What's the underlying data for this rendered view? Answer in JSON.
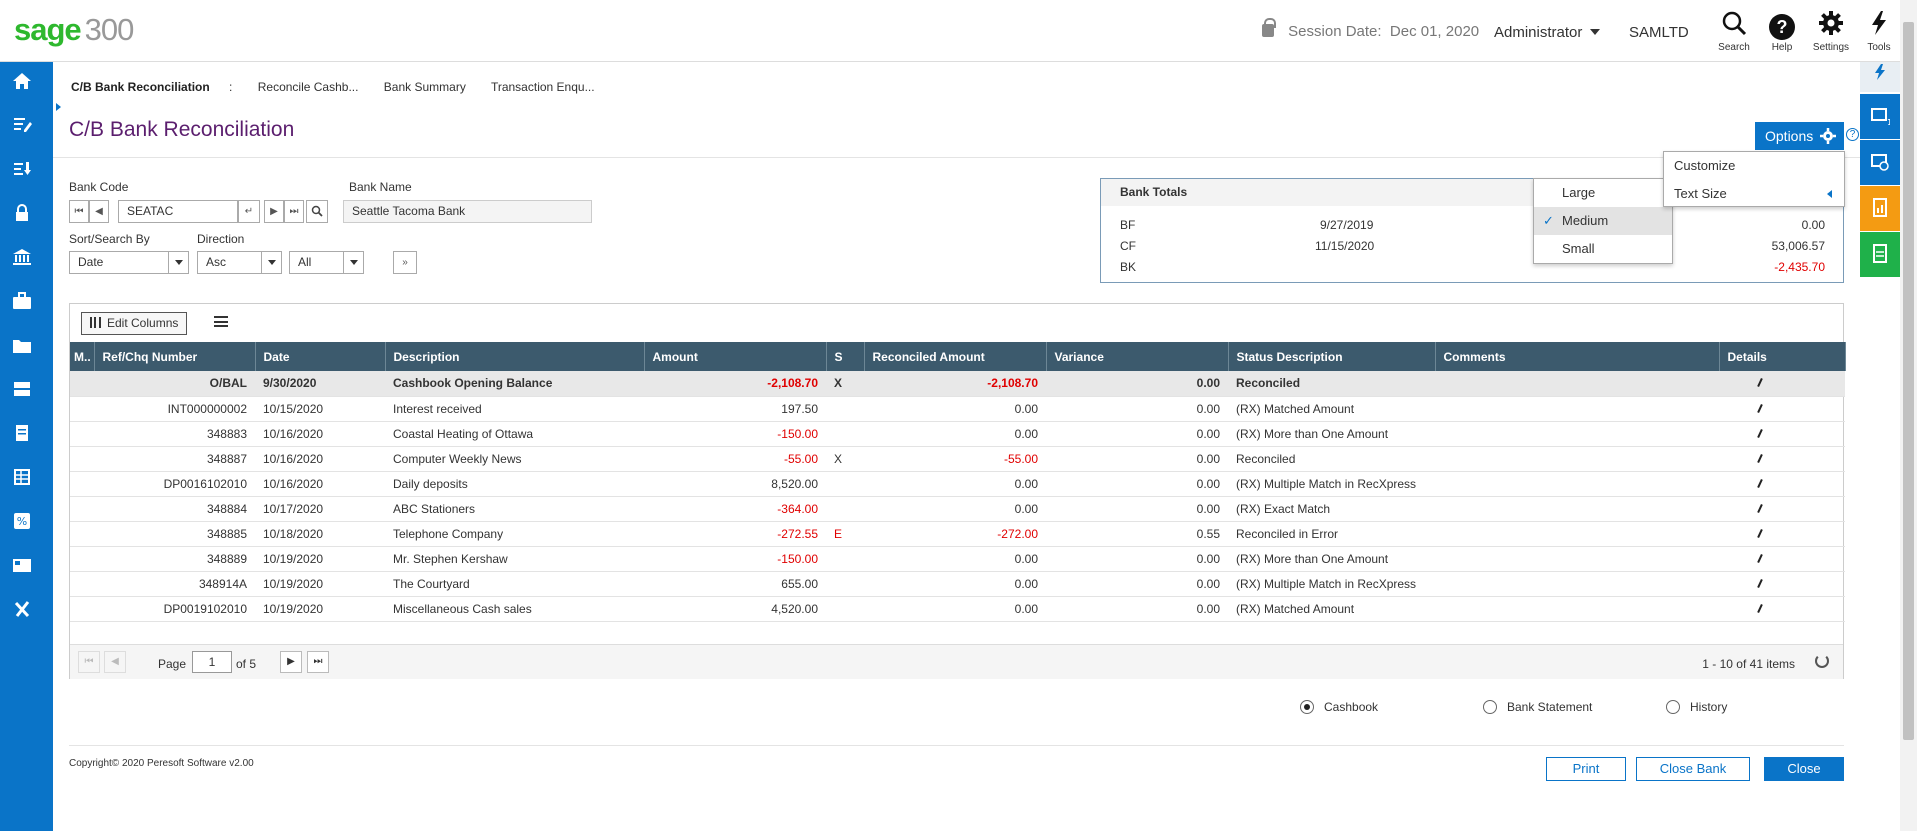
{
  "app": {
    "logo_brand": "sage",
    "logo_version": "300"
  },
  "header": {
    "session_label": "Session Date:",
    "session_date": "Dec 01, 2020",
    "user": "Administrator",
    "company": "SAMLTD",
    "icons": [
      {
        "name": "search-icon",
        "label": "Search"
      },
      {
        "name": "help-icon",
        "label": "Help"
      },
      {
        "name": "settings-icon",
        "label": "Settings"
      },
      {
        "name": "tools-icon",
        "label": "Tools"
      }
    ]
  },
  "breadcrumb": {
    "items": [
      "C/B Bank Reconciliation",
      ":",
      "Reconcile Cashb...",
      "Bank Summary",
      "Transaction Enqu..."
    ]
  },
  "page": {
    "title": "C/B Bank Reconciliation",
    "options_label": "Options"
  },
  "form": {
    "bank_code_label": "Bank Code",
    "bank_code_value": "SEATAC",
    "bank_name_label": "Bank Name",
    "bank_name_value": "Seattle Tacoma Bank",
    "sort_label": "Sort/Search By",
    "sort_value": "Date",
    "direction_label": "Direction",
    "direction_value": "Asc",
    "filter_value": "All"
  },
  "bank_totals": {
    "title": "Bank Totals",
    "rows": [
      {
        "code": "BF",
        "date": "9/27/2019",
        "amount": "0.00"
      },
      {
        "code": "CF",
        "date": "11/15/2020",
        "amount": "53,006.57"
      },
      {
        "code": "BK",
        "date": "",
        "amount": "-2,435.70"
      }
    ]
  },
  "options_menu": {
    "items": [
      "Customize",
      "Text Size"
    ]
  },
  "text_size_menu": {
    "items": [
      "Large",
      "Medium",
      "Small"
    ],
    "selected": "Medium"
  },
  "grid": {
    "edit_columns_label": "Edit Columns",
    "columns": [
      "M..",
      "Ref/Chq Number",
      "Date",
      "Description",
      "Amount",
      "S",
      "Reconciled Amount",
      "Variance",
      "Status Description",
      "Comments",
      "Details"
    ],
    "rows": [
      {
        "ref": "O/BAL",
        "date": "9/30/2020",
        "desc": "Cashbook Opening Balance",
        "amount": "-2,108.70",
        "s": "X",
        "rec": "-2,108.70",
        "var": "0.00",
        "status": "Reconciled",
        "comments": ""
      },
      {
        "ref": "INT000000002",
        "date": "10/15/2020",
        "desc": "Interest received",
        "amount": "197.50",
        "s": "",
        "rec": "0.00",
        "var": "0.00",
        "status": "(RX) Matched Amount",
        "comments": ""
      },
      {
        "ref": "348883",
        "date": "10/16/2020",
        "desc": "Coastal Heating of Ottawa",
        "amount": "-150.00",
        "s": "",
        "rec": "0.00",
        "var": "0.00",
        "status": "(RX) More than One Amount",
        "comments": ""
      },
      {
        "ref": "348887",
        "date": "10/16/2020",
        "desc": "Computer Weekly News",
        "amount": "-55.00",
        "s": "X",
        "rec": "-55.00",
        "var": "0.00",
        "status": "Reconciled",
        "comments": ""
      },
      {
        "ref": "DP0016102010",
        "date": "10/16/2020",
        "desc": "Daily deposits",
        "amount": "8,520.00",
        "s": "",
        "rec": "0.00",
        "var": "0.00",
        "status": "(RX) Multiple Match in RecXpress",
        "comments": ""
      },
      {
        "ref": "348884",
        "date": "10/17/2020",
        "desc": "ABC Stationers",
        "amount": "-364.00",
        "s": "",
        "rec": "0.00",
        "var": "0.00",
        "status": "(RX) Exact Match",
        "comments": ""
      },
      {
        "ref": "348885",
        "date": "10/18/2020",
        "desc": "Telephone Company",
        "amount": "-272.55",
        "s": "E",
        "rec": "-272.00",
        "var": "0.55",
        "status": "Reconciled in Error",
        "comments": ""
      },
      {
        "ref": "348889",
        "date": "10/19/2020",
        "desc": "Mr. Stephen Kershaw",
        "amount": "-150.00",
        "s": "",
        "rec": "0.00",
        "var": "0.00",
        "status": "(RX) More than One Amount",
        "comments": ""
      },
      {
        "ref": "348914A",
        "date": "10/19/2020",
        "desc": "The Courtyard",
        "amount": "655.00",
        "s": "",
        "rec": "0.00",
        "var": "0.00",
        "status": "(RX) Multiple Match in RecXpress",
        "comments": ""
      },
      {
        "ref": "DP0019102010",
        "date": "10/19/2020",
        "desc": "Miscellaneous Cash sales",
        "amount": "4,520.00",
        "s": "",
        "rec": "0.00",
        "var": "0.00",
        "status": "(RX) Matched Amount",
        "comments": ""
      }
    ]
  },
  "pager": {
    "page_label": "Page",
    "page_value": "1",
    "of_label": "of 5",
    "items_label": "1 - 10 of 41 items"
  },
  "view_options": {
    "items": [
      "Cashbook",
      "Bank Statement",
      "History"
    ],
    "selected": "Cashbook"
  },
  "footer": {
    "copyright": "Copyright© 2020 Peresoft Software v2.00",
    "print_label": "Print",
    "close_bank_label": "Close Bank",
    "close_label": "Close"
  },
  "colors": {
    "accent": "#0a74c8",
    "title": "#5b1e6e",
    "grid_header": "#3c5a6d",
    "negative": "#e00000",
    "brand": "#2eb82e"
  }
}
